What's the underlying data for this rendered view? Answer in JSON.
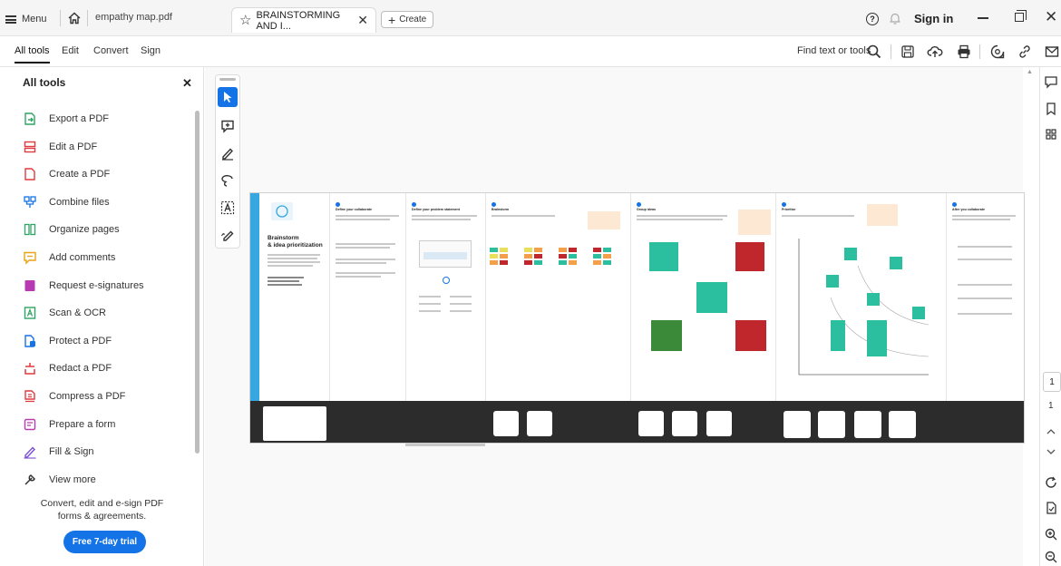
{
  "tabbar": {
    "menu_label": "Menu",
    "file_tab": "empathy map.pdf",
    "active_tab": "BRAINSTORMING AND I...",
    "create_label": "Create",
    "signin": "Sign in"
  },
  "toolbar": {
    "menu": [
      "All tools",
      "Edit",
      "Convert",
      "Sign"
    ],
    "find_label": "Find text or tools"
  },
  "panel": {
    "title": "All tools",
    "tools": [
      {
        "label": "Export a PDF",
        "icon": "export-pdf-icon",
        "color": "#2da562"
      },
      {
        "label": "Edit a PDF",
        "icon": "edit-pdf-icon",
        "color": "#e03a3e"
      },
      {
        "label": "Create a PDF",
        "icon": "create-pdf-icon",
        "color": "#e03a3e"
      },
      {
        "label": "Combine files",
        "icon": "combine-files-icon",
        "color": "#1473e6"
      },
      {
        "label": "Organize pages",
        "icon": "organize-pages-icon",
        "color": "#2da562"
      },
      {
        "label": "Add comments",
        "icon": "add-comments-icon",
        "color": "#e8a317"
      },
      {
        "label": "Request e-signatures",
        "icon": "request-esign-icon",
        "color": "#b83ab0"
      },
      {
        "label": "Scan & OCR",
        "icon": "scan-ocr-icon",
        "color": "#2da562"
      },
      {
        "label": "Protect a PDF",
        "icon": "protect-pdf-icon",
        "color": "#1473e6"
      },
      {
        "label": "Redact a PDF",
        "icon": "redact-pdf-icon",
        "color": "#e03a3e"
      },
      {
        "label": "Compress a PDF",
        "icon": "compress-pdf-icon",
        "color": "#e03a3e"
      },
      {
        "label": "Prepare a form",
        "icon": "prepare-form-icon",
        "color": "#b83ab0"
      },
      {
        "label": "Fill & Sign",
        "icon": "fill-sign-icon",
        "color": "#7a4fd6"
      },
      {
        "label": "View more",
        "icon": "view-more-icon",
        "color": "#333333"
      }
    ],
    "promo_line1": "Convert, edit and e-sign PDF",
    "promo_line2": "forms & agreements.",
    "trial_button": "Free 7-day trial"
  },
  "document": {
    "cover_title": "Brainstorm",
    "cover_subtitle": "& idea prioritization",
    "columns": [
      {
        "heading": "Define your collaborate"
      },
      {
        "heading": "Define your problem statement"
      },
      {
        "heading": "Brainstorm"
      },
      {
        "heading": "Group ideas"
      },
      {
        "heading": "Prioritize"
      },
      {
        "heading": "After you collaborate"
      }
    ]
  },
  "pages": {
    "current": "1",
    "total": "1"
  },
  "colors": {
    "accent": "#1473e6",
    "strip": "#36a7e0",
    "teal": "#2bbf9f",
    "green": "#3a8a3a",
    "red": "#c0272d",
    "dark": "#2c2c2c"
  }
}
